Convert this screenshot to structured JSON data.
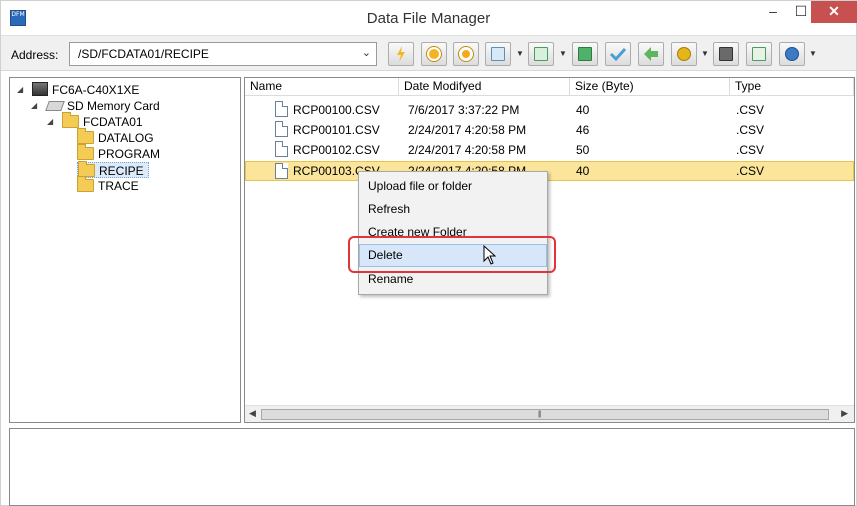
{
  "window": {
    "title": "Data File Manager",
    "app_icon_text": "DFM",
    "minimize": "–",
    "maximize": "☐",
    "close": "✕"
  },
  "toolbar": {
    "address_label": "Address:",
    "address_value": "/SD/FCDATA01/RECIPE",
    "tools": [
      "connect-icon",
      "run-icon",
      "stop-icon",
      "download-icon",
      "upload-icon",
      "transfer-icon",
      "check-icon",
      "back-icon",
      "settings-icon",
      "export-icon",
      "import-icon",
      "help-icon"
    ]
  },
  "tree": {
    "root": "FC6A-C40X1XE",
    "sd_card": "SD Memory Card",
    "folder": "FCDATA01",
    "children": [
      "DATALOG",
      "PROGRAM",
      "RECIPE",
      "TRACE"
    ],
    "selected": "RECIPE"
  },
  "filelist": {
    "columns": [
      "Name",
      "Date Modifyed",
      "Size (Byte)",
      "Type"
    ],
    "rows": [
      {
        "name": "RCP00100.CSV",
        "date": "7/6/2017 3:37:22 PM",
        "size": "40",
        "type": ".CSV"
      },
      {
        "name": "RCP00101.CSV",
        "date": "2/24/2017 4:20:58 PM",
        "size": "46",
        "type": ".CSV"
      },
      {
        "name": "RCP00102.CSV",
        "date": "2/24/2017 4:20:58 PM",
        "size": "50",
        "type": ".CSV"
      },
      {
        "name": "RCP00103.CSV",
        "date": "2/24/2017 4:20:58 PM",
        "size": "40",
        "type": ".CSV"
      }
    ],
    "selected_row": 3
  },
  "context_menu": {
    "items": [
      "Upload file or folder",
      "Refresh",
      "Create new Folder",
      "Delete",
      "Rename"
    ],
    "hovered": "Delete"
  },
  "colors": {
    "selection": "#fbe59a",
    "menu_hover": "#d7e6f8",
    "highlight": "#e0343c",
    "close_button": "#c75050"
  }
}
